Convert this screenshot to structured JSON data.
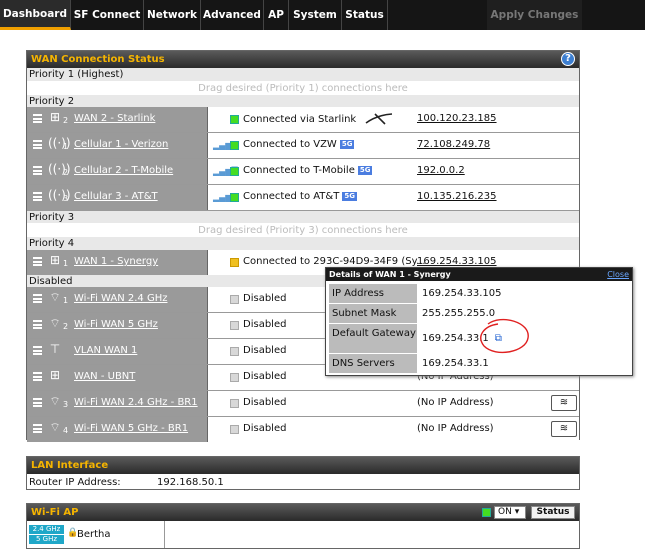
{
  "nav": {
    "tabs": [
      "Dashboard",
      "SF Connect",
      "Network",
      "Advanced",
      "AP",
      "System",
      "Status"
    ],
    "apply_label": "Apply Changes"
  },
  "wan": {
    "title": "WAN Connection Status",
    "p1_label": "Priority 1 (Highest)",
    "p1_drag": "Drag desired (Priority 1) connections here",
    "p2_label": "Priority 2",
    "p3_label": "Priority 3",
    "p3_drag": "Drag desired (Priority 3) connections here",
    "p4_label": "Priority 4",
    "disabled_label": "Disabled",
    "connections": [
      {
        "num": "2",
        "name": "WAN 2 - Starlink",
        "status": "Connected via Starlink",
        "ip": "100.120.23.185",
        "icon": "network-icon"
      },
      {
        "num": "1",
        "name": "Cellular 1 - Verizon",
        "status": "Connected to VZW",
        "badge": "5G",
        "ip": "72.108.249.78",
        "icon": "cellular-icon"
      },
      {
        "num": "2",
        "name": "Cellular 2 - T-Mobile",
        "status": "Connected to T-Mobile",
        "badge": "5G",
        "ip": "192.0.0.2",
        "icon": "cellular-icon"
      },
      {
        "num": "3",
        "name": "Cellular 3 - AT&T",
        "status": "Connected to AT&T",
        "badge": "5G",
        "ip": "10.135.216.235",
        "icon": "cellular-icon"
      },
      {
        "num": "1",
        "name": "WAN 1 - Synergy",
        "status": "Connected to 293C-94D9-34F9 (Sy...",
        "ip": "169.254.33.105",
        "icon": "network-icon"
      }
    ],
    "disabled": [
      {
        "num": "1",
        "name": "Wi-Fi WAN 2.4 GHz",
        "status": "Disabled",
        "icon": "wifi-icon"
      },
      {
        "num": "2",
        "name": "Wi-Fi WAN 5 GHz",
        "status": "Disabled",
        "icon": "wifi-icon"
      },
      {
        "num": "",
        "name": "VLAN WAN 1",
        "status": "Disabled",
        "icon": "vlan-icon"
      },
      {
        "num": "",
        "name": "WAN - UBNT",
        "status": "Disabled",
        "ip": "(No IP Address)",
        "icon": "network-icon"
      },
      {
        "num": "3",
        "name": "Wi-Fi WAN 2.4 GHz - BR1",
        "status": "Disabled",
        "ip": "(No IP Address)",
        "icon": "wifi-icon"
      },
      {
        "num": "4",
        "name": "Wi-Fi WAN 5 GHz - BR1",
        "status": "Disabled",
        "ip": "(No IP Address)",
        "icon": "wifi-icon"
      }
    ]
  },
  "popup": {
    "title": "Details of WAN 1 - Synergy",
    "close": "Close",
    "rows": [
      {
        "k": "IP Address",
        "v": "169.254.33.105"
      },
      {
        "k": "Subnet Mask",
        "v": "255.255.255.0"
      },
      {
        "k": "Default Gateway",
        "v": "169.254.33.1"
      },
      {
        "k": "DNS Servers",
        "v": "169.254.33.1"
      }
    ]
  },
  "lan": {
    "title": "LAN Interface",
    "router_label": "Router IP Address:",
    "router_ip": "192.168.50.1"
  },
  "wifiap": {
    "title": "Wi-Fi AP",
    "on_value": "ON",
    "status_btn": "Status",
    "band1": "2.4 GHz",
    "band2": "5 GHz",
    "ssid": "Bertha"
  }
}
